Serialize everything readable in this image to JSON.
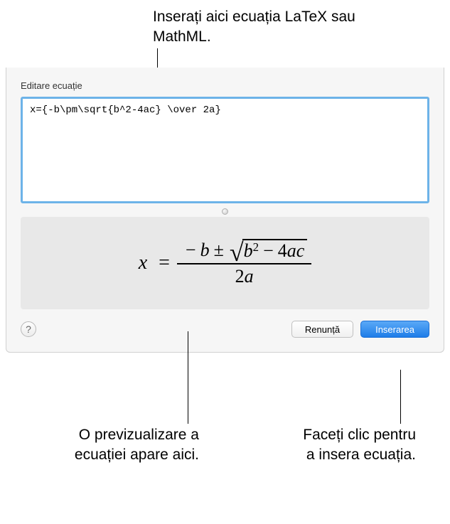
{
  "callouts": {
    "top": "Inserați aici ecuația LaTeX sau MathML.",
    "preview": "O previzualizare a ecuației apare aici.",
    "insert": "Faceți clic pentru a insera ecuația."
  },
  "dialog": {
    "title": "Editare ecuație",
    "equation_source": "x={-b\\pm\\sqrt{b^2-4ac} \\over 2a}",
    "help_label": "?",
    "cancel_label": "Renunță",
    "insert_label": "Inserarea"
  },
  "preview": {
    "lhs": "x",
    "equals": "=",
    "minus": "−",
    "b": "b",
    "pm": "±",
    "sqrt_b": "b",
    "sqrt_exp": "2",
    "sqrt_minus": "−",
    "four": "4",
    "a": "a",
    "c": "c",
    "den_two": "2",
    "den_a": "a"
  }
}
